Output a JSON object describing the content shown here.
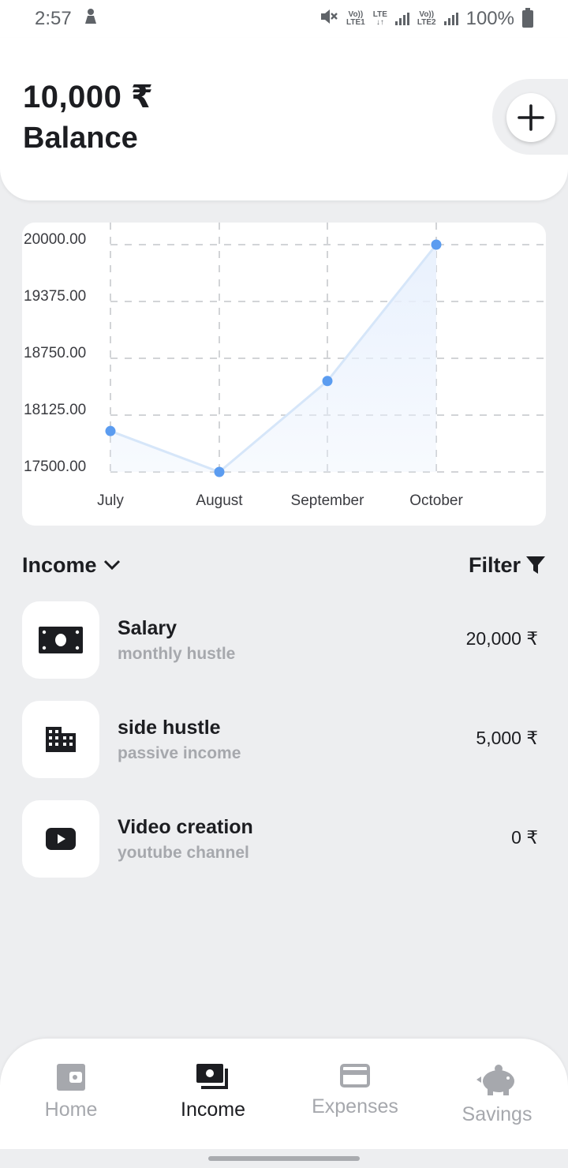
{
  "status_bar": {
    "time": "2:57",
    "sim1_label_top": "Vo))",
    "sim1_label_bottom": "LTE1",
    "lte_label_top": "LTE",
    "lte_label_bottom": "↓↑",
    "sim2_label_top": "Vo))",
    "sim2_label_bottom": "LTE2",
    "battery": "100%"
  },
  "header": {
    "balance_amount": "10,000 ₹",
    "balance_label": "Balance",
    "add_icon": "plus-icon"
  },
  "chart_data": {
    "type": "line",
    "categories": [
      "July",
      "August",
      "September",
      "October"
    ],
    "values": [
      17950,
      17500,
      18500,
      20000
    ],
    "ytick_labels": [
      "20000.00",
      "19375.00",
      "18750.00",
      "18125.00",
      "17500.00"
    ],
    "ylim": [
      17500,
      20000
    ],
    "grid": true,
    "fill": "area",
    "colors": {
      "line": "#d6e6f9",
      "point": "#5b9cf0",
      "fill": "#e9f1fd"
    }
  },
  "section": {
    "title": "Income",
    "dropdown_icon": "chevron-down-icon",
    "filter_label": "Filter",
    "filter_icon": "funnel-icon"
  },
  "income_items": [
    {
      "title": "Salary",
      "subtitle": "monthly hustle",
      "amount": "20,000 ₹",
      "icon": "banknote-icon"
    },
    {
      "title": "side hustle",
      "subtitle": "passive income",
      "amount": "5,000 ₹",
      "icon": "building-icon"
    },
    {
      "title": "Video creation",
      "subtitle": "youtube channel",
      "amount": "0 ₹",
      "icon": "youtube-icon"
    }
  ],
  "nav": [
    {
      "label": "Home",
      "icon": "wallet-icon",
      "active": false
    },
    {
      "label": "Income",
      "icon": "payments-icon",
      "active": true
    },
    {
      "label": "Expenses",
      "icon": "credit-card-icon",
      "active": false
    },
    {
      "label": "Savings",
      "icon": "piggy-bank-icon",
      "active": false
    }
  ],
  "colors": {
    "background": "#edeef0",
    "card": "#ffffff",
    "text_primary": "#1c1d21",
    "text_muted": "#a6a8ad",
    "accent_point": "#5b9cf0"
  }
}
